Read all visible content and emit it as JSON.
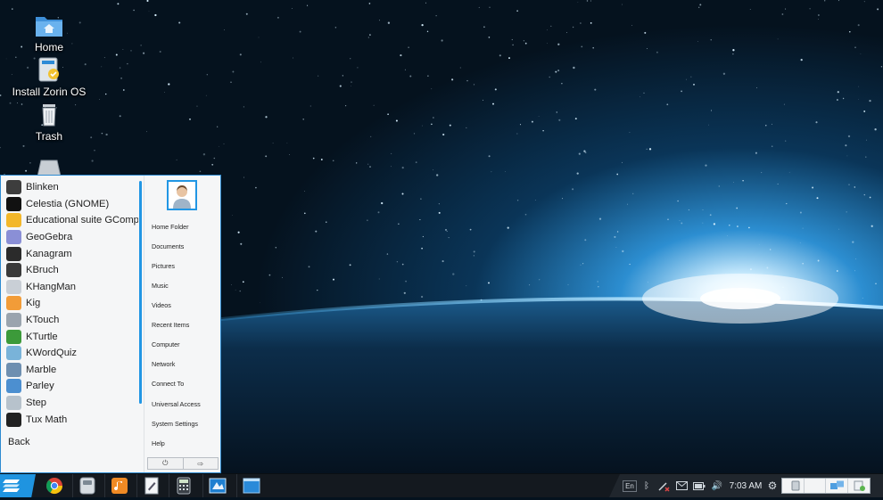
{
  "desktop": {
    "icons": [
      {
        "label": "Home",
        "icon": "home-folder-icon"
      },
      {
        "label": "Install Zorin OS",
        "icon": "installer-icon"
      },
      {
        "label": "Trash",
        "icon": "trash-icon"
      },
      {
        "label": "",
        "icon": "drive-icon"
      }
    ]
  },
  "menu": {
    "apps": [
      {
        "label": "Blinken",
        "icon": "blinken-icon",
        "color": "#3d3d3d"
      },
      {
        "label": "Celestia (GNOME)",
        "icon": "celestia-icon",
        "color": "#111111"
      },
      {
        "label": "Educational suite GCompris",
        "icon": "gcompris-icon",
        "color": "#f3b72a"
      },
      {
        "label": "GeoGebra",
        "icon": "geogebra-icon",
        "color": "#8a8fd6"
      },
      {
        "label": "Kanagram",
        "icon": "kanagram-icon",
        "color": "#2b2b2b"
      },
      {
        "label": "KBruch",
        "icon": "kbruch-icon",
        "color": "#3a3a3a"
      },
      {
        "label": "KHangMan",
        "icon": "khangman-icon",
        "color": "#c9cfd6"
      },
      {
        "label": "Kig",
        "icon": "kig-icon",
        "color": "#f29c38"
      },
      {
        "label": "KTouch",
        "icon": "ktouch-icon",
        "color": "#9aa4ae"
      },
      {
        "label": "KTurtle",
        "icon": "kturtle-icon",
        "color": "#3c9a3a"
      },
      {
        "label": "KWordQuiz",
        "icon": "kwordquiz-icon",
        "color": "#79b3d9"
      },
      {
        "label": "Marble",
        "icon": "marble-icon",
        "color": "#6e8fb0"
      },
      {
        "label": "Parley",
        "icon": "parley-icon",
        "color": "#4c8fd0"
      },
      {
        "label": "Step",
        "icon": "step-icon",
        "color": "#b7c2cc"
      },
      {
        "label": "Tux Math",
        "icon": "tux-icon",
        "color": "#222222"
      }
    ],
    "back_label": "Back",
    "places": [
      "Home Folder",
      "Documents",
      "Pictures",
      "Music",
      "Videos",
      "Recent Items",
      "Computer",
      "Network",
      "Connect To",
      "Universal Access",
      "System Settings",
      "Help"
    ],
    "power_icon": "power-icon",
    "logout_icon": "logout-icon"
  },
  "taskbar": {
    "launchers": [
      {
        "icon": "chrome-icon"
      },
      {
        "icon": "files-icon"
      },
      {
        "icon": "music-player-icon"
      },
      {
        "icon": "text-editor-icon"
      },
      {
        "icon": "calculator-icon"
      },
      {
        "icon": "zorin-look-changer-icon"
      },
      {
        "icon": "window-icon"
      }
    ],
    "tray": {
      "keyboard_layout": "En",
      "bluetooth_icon": "bluetooth-icon",
      "network_icon": "network-disconnected-icon",
      "mail_icon": "mail-icon",
      "battery_icon": "battery-icon",
      "volume_icon": "volume-icon",
      "clock": "7:03 AM",
      "settings_icon": "gear-icon"
    },
    "workspace_count": 4
  },
  "colors": {
    "accent": "#1f94e0",
    "taskbar": "#14191f",
    "menu_bg": "#f5f6f7"
  }
}
